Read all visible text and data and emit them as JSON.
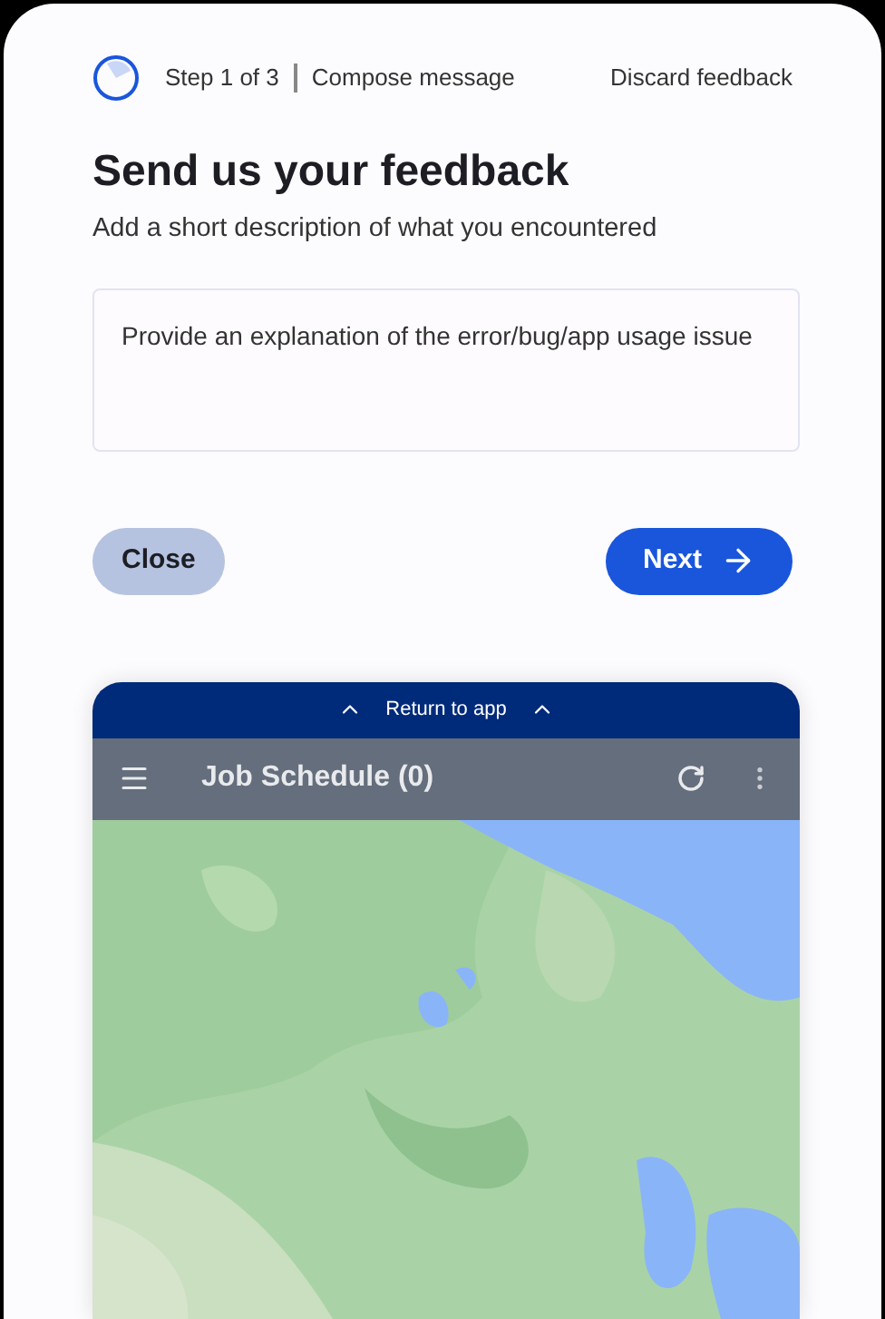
{
  "header": {
    "step": "Step 1 of 3",
    "step_name": "Compose message",
    "discard": "Discard feedback"
  },
  "title": "Send us your feedback",
  "subtitle": "Add a short description of what you encountered",
  "description_field": {
    "placeholder": "Provide an explanation of the error/bug/app usage issue"
  },
  "buttons": {
    "close": "Close",
    "next": "Next"
  },
  "app_preview": {
    "return_bar": "Return to app",
    "app_title": "Job Schedule (0)"
  }
}
